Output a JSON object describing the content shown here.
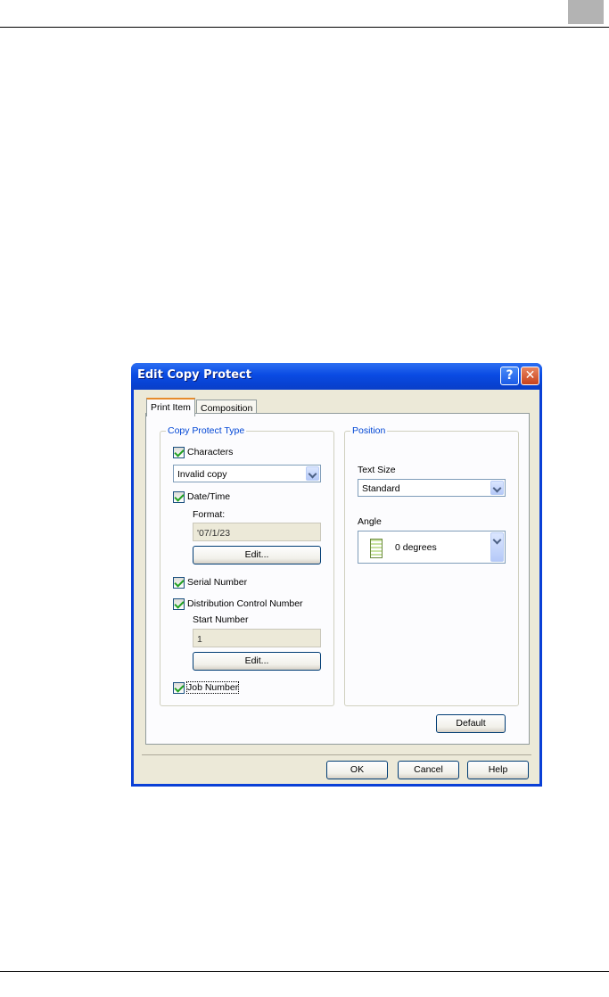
{
  "dialog": {
    "title": "Edit Copy Protect",
    "help_glyph": "?",
    "close_glyph": "✕"
  },
  "tabs": [
    {
      "label": "Print Item",
      "active": true
    },
    {
      "label": "Composition",
      "active": false
    }
  ],
  "copy_protect_type": {
    "group_label": "Copy Protect Type",
    "characters": {
      "label": "Characters",
      "checked": true,
      "value": "Invalid copy"
    },
    "date_time": {
      "label": "Date/Time",
      "checked": true,
      "format_label": "Format:",
      "format_value": "'07/1/23",
      "edit_label": "Edit..."
    },
    "serial_number": {
      "label": "Serial Number",
      "checked": true
    },
    "distribution_control": {
      "label": "Distribution Control Number",
      "checked": true,
      "start_label": "Start Number",
      "start_value": "1",
      "edit_label": "Edit..."
    },
    "job_number": {
      "label": "Job Number",
      "checked": true
    }
  },
  "position": {
    "group_label": "Position",
    "text_size_label": "Text Size",
    "text_size_value": "Standard",
    "angle_label": "Angle",
    "angle_value": "0 degrees"
  },
  "buttons": {
    "default": "Default",
    "ok": "OK",
    "cancel": "Cancel",
    "help": "Help"
  },
  "colors": {
    "titlebar": "#0a4be3",
    "dialog_face": "#ece9d8",
    "group_label": "#0046d5",
    "check": "#21a121"
  }
}
